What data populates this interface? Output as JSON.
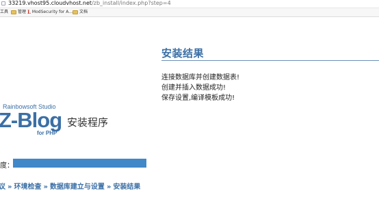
{
  "browser": {
    "url_host": "33219.vhost95.cloudvhost.net",
    "url_path": "/zb_install/index.php?step=4",
    "bookmarks": [
      {
        "label": "工具",
        "icon": "none"
      },
      {
        "label": "管理",
        "icon": "folder-icon"
      },
      {
        "label": "ModSecurity for A...",
        "icon": "l-logo-icon"
      },
      {
        "label": "文档",
        "icon": "folder-icon"
      }
    ]
  },
  "result": {
    "title": "安装结果",
    "messages": [
      "连接数据库并创建数据表!",
      "创建并插入数据成功!",
      "保存设置,编译模板成功!"
    ]
  },
  "logo": {
    "studio": "Rainbowsoft Studio",
    "brand": "Z-Blog",
    "for_php": "for PHP",
    "installer": "安装程序"
  },
  "progress": {
    "label": "度：",
    "value": 1.0,
    "fill_color": "#4088c8"
  },
  "steps": {
    "items": [
      "议",
      "环境检查",
      "数据库建立与设置",
      "安装结果"
    ],
    "separator": "»"
  }
}
